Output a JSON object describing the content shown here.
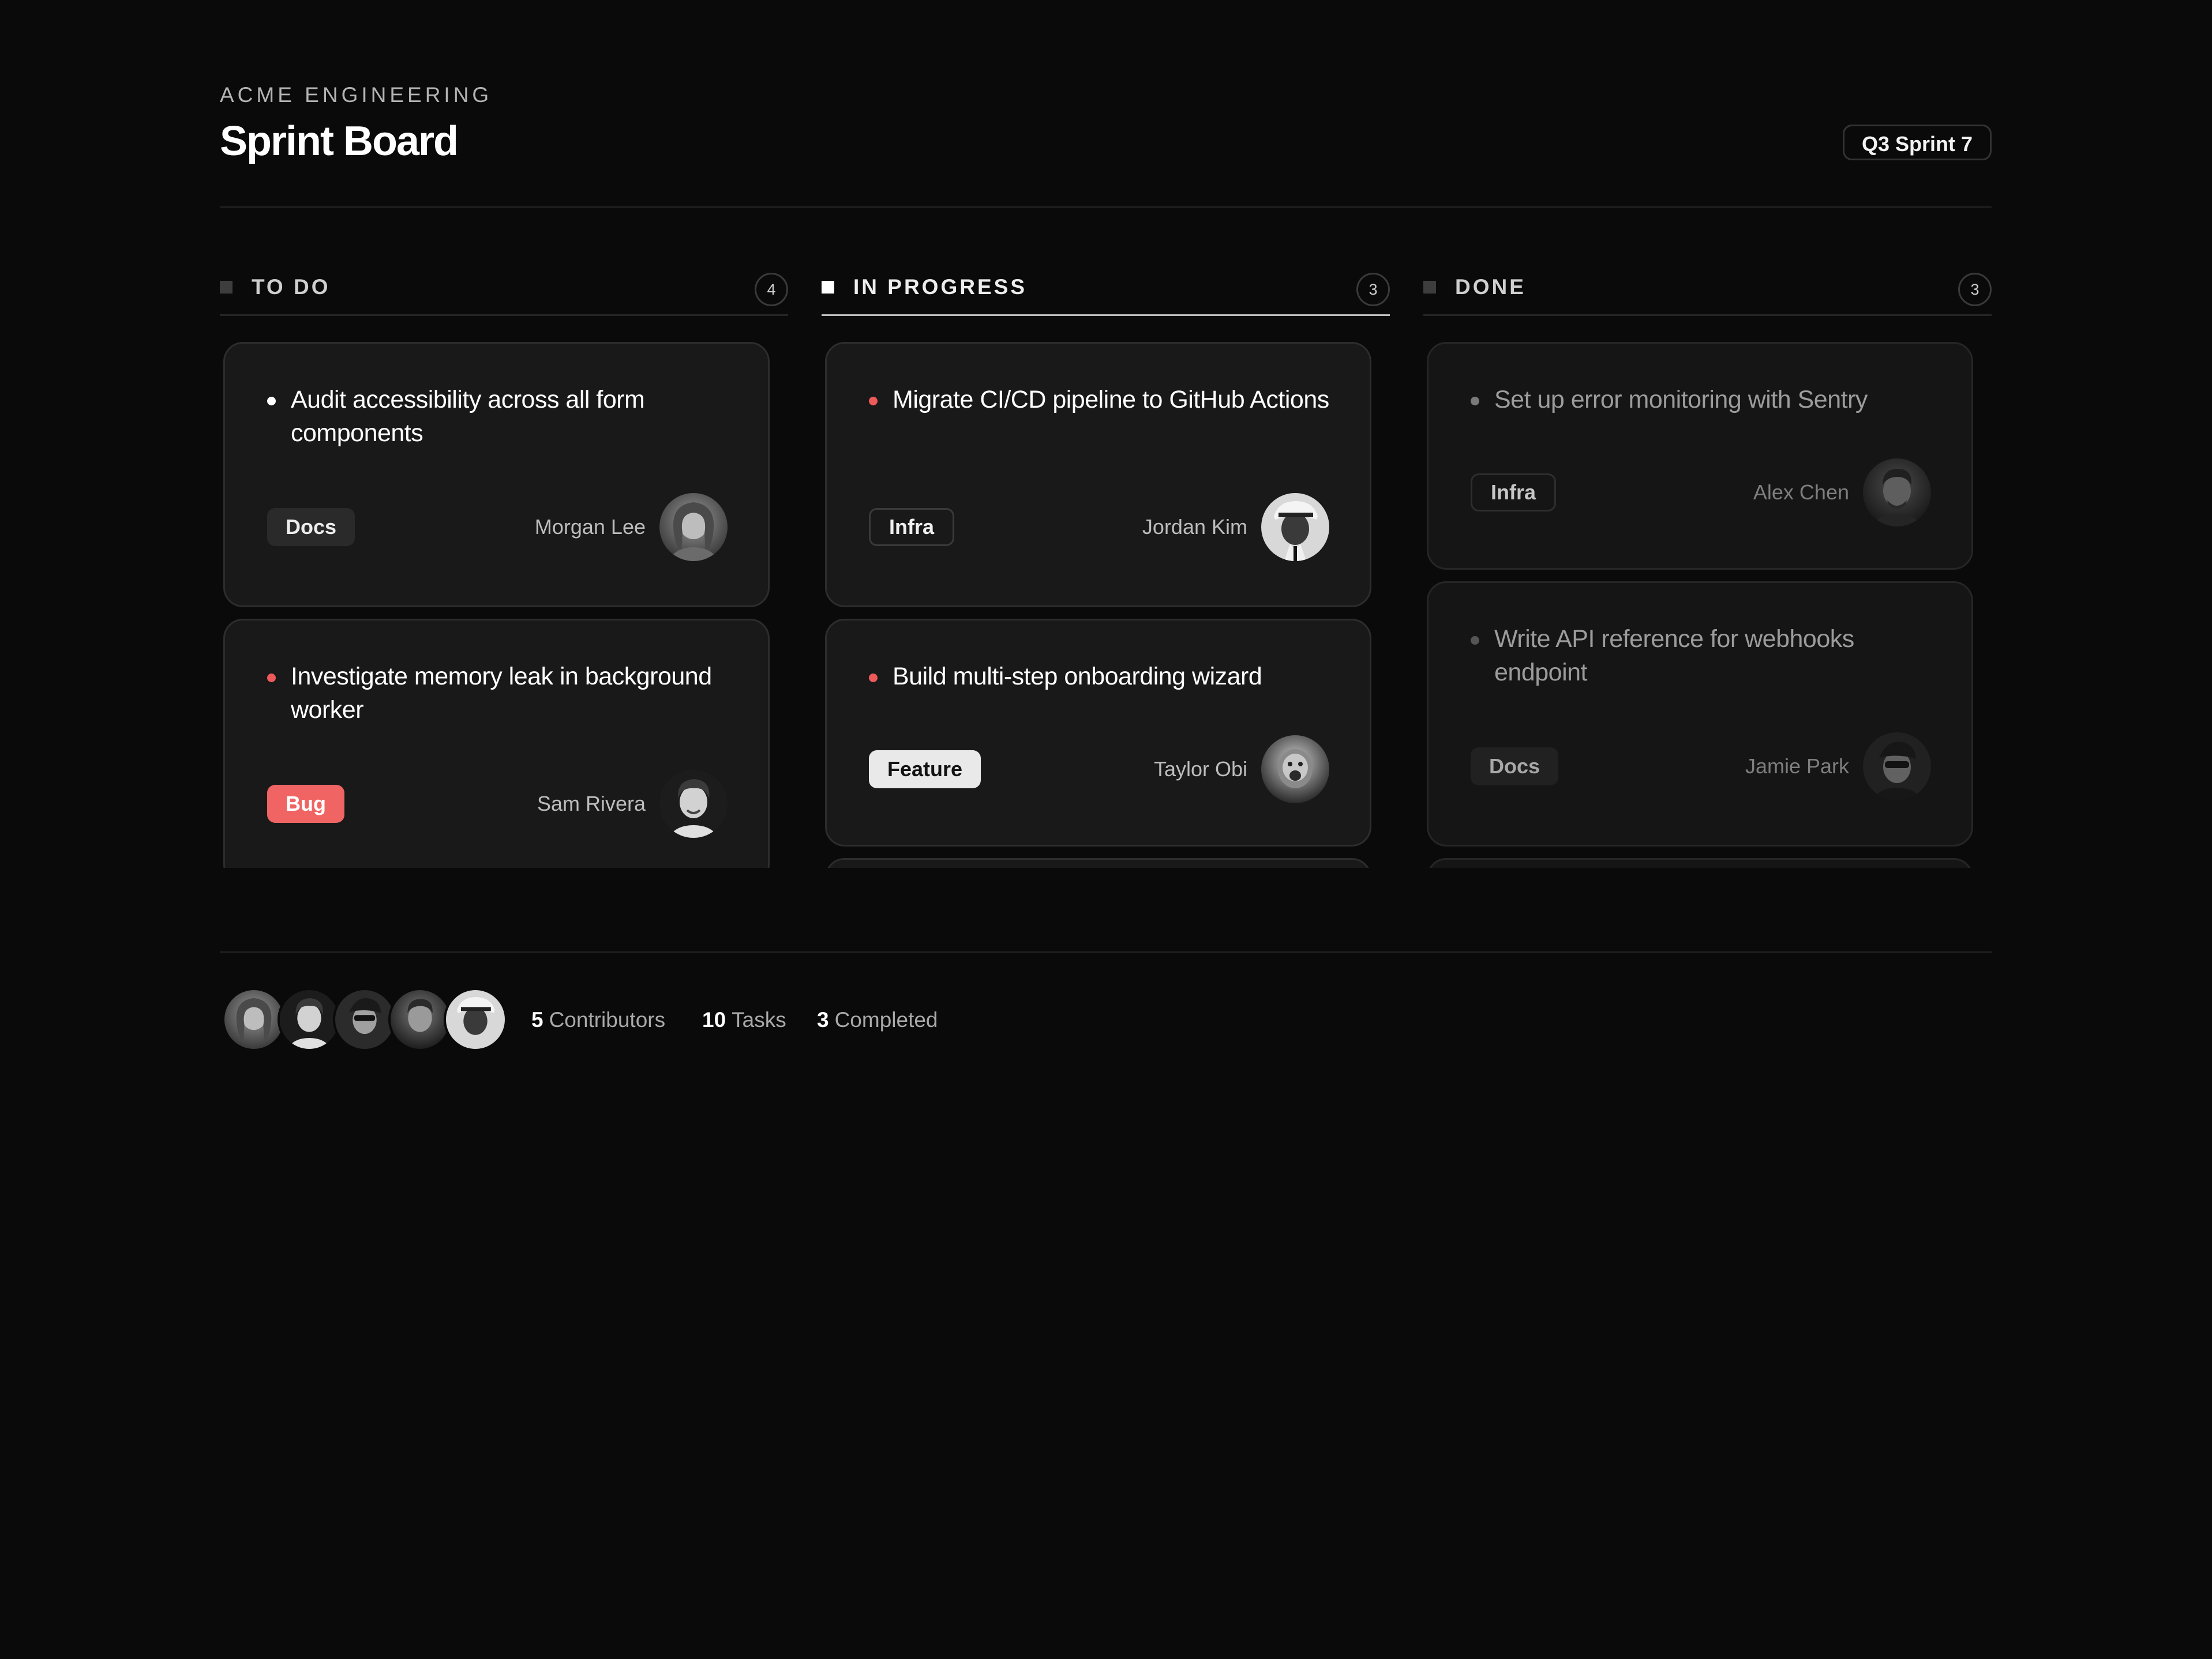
{
  "header": {
    "org": "ACME ENGINEERING",
    "title": "Sprint Board",
    "sprint": "Q3 Sprint 7"
  },
  "columns": [
    {
      "title": "TO DO",
      "count": "4",
      "cards": [
        {
          "task": "Audit accessibility across all form components",
          "tag": "Docs",
          "assignee": "Morgan Lee",
          "avatar_icon": "avatar-photo"
        },
        {
          "task": "Investigate memory leak in background worker",
          "tag": "Bug",
          "assignee": "Sam Rivera",
          "avatar_icon": "avatar-photo"
        }
      ]
    },
    {
      "title": "IN PROGRESS",
      "count": "3",
      "cards": [
        {
          "task": "Migrate CI/CD pipeline to GitHub Actions",
          "tag": "Infra",
          "assignee": "Jordan Kim",
          "avatar_icon": "avatar-photo"
        },
        {
          "task": "Build multi-step onboarding wizard",
          "tag": "Feature",
          "assignee": "Taylor Obi",
          "avatar_icon": "avatar-photo"
        }
      ]
    },
    {
      "title": "DONE",
      "count": "3",
      "cards": [
        {
          "task": "Set up error monitoring with Sentry",
          "tag": "Infra",
          "assignee": "Alex Chen",
          "avatar_icon": "avatar-photo"
        },
        {
          "task": "Write API reference for webhooks endpoint",
          "tag": "Docs",
          "assignee": "Jamie Park",
          "avatar_icon": "avatar-photo"
        }
      ]
    }
  ],
  "footer": {
    "contributors_count": "5",
    "contributors_label": "Contributors",
    "tasks_count": "10",
    "tasks_label": "Tasks",
    "completed_count": "3",
    "completed_label": "Completed"
  },
  "colors": {
    "background": "#0a0a0a",
    "card": "#191919",
    "priority_dot": "#ee5a5a",
    "bug_tag": "#f06464",
    "feature_tag": "#e9e9e9"
  }
}
